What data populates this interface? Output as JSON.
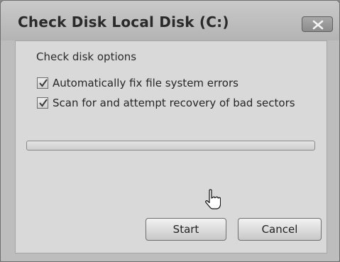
{
  "window": {
    "title": "Check Disk Local Disk (C:)"
  },
  "dialog": {
    "group_label": "Check disk options",
    "options": [
      {
        "label": "Automatically fix file system errors",
        "checked": true
      },
      {
        "label": "Scan for and attempt recovery of bad sectors",
        "checked": true
      }
    ],
    "progress": {
      "value": 0
    },
    "buttons": {
      "start_label": "Start",
      "cancel_label": "Cancel"
    }
  },
  "icons": {
    "close": "close-icon",
    "checkmark": "checkmark-icon",
    "cursor": "hand-pointer-icon"
  }
}
